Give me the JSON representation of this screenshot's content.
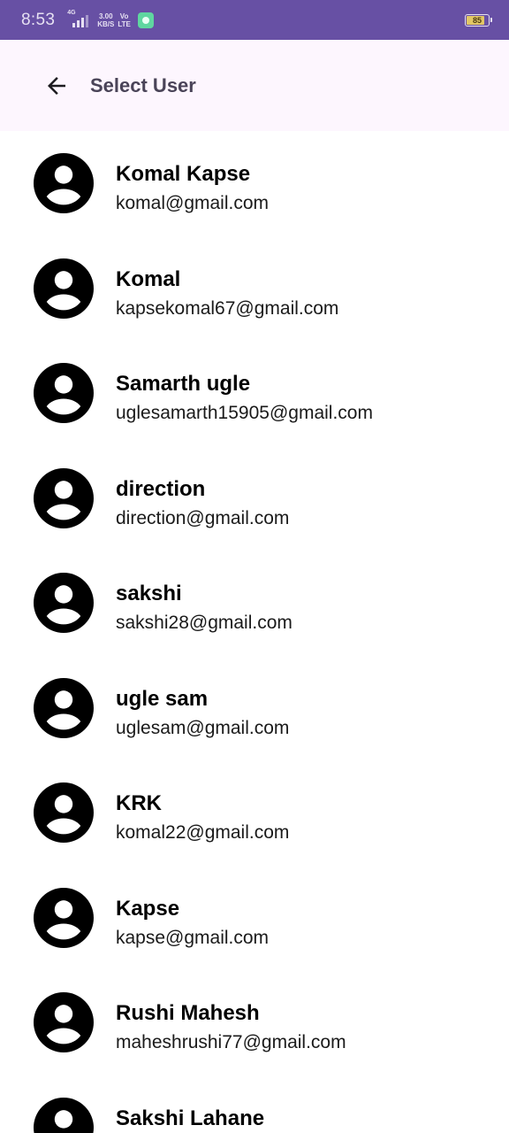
{
  "status_bar": {
    "time": "8:53",
    "network_tag": "4G",
    "speed_value": "3.00",
    "speed_unit": "KB/S",
    "volte_top": "Vo",
    "volte_bottom": "LTE",
    "battery_level": "85",
    "battery_fraction": 0.85
  },
  "app_bar": {
    "back_icon": "arrow-left-icon",
    "title": "Select User"
  },
  "users": [
    {
      "name": "Komal Kapse",
      "email": "komal@gmail.com"
    },
    {
      "name": "Komal",
      "email": "kapsekomal67@gmail.com"
    },
    {
      "name": "Samarth ugle",
      "email": "uglesamarth15905@gmail.com"
    },
    {
      "name": "direction",
      "email": "direction@gmail.com"
    },
    {
      "name": "sakshi",
      "email": "sakshi28@gmail.com"
    },
    {
      "name": "ugle sam",
      "email": "uglesam@gmail.com"
    },
    {
      "name": "KRK",
      "email": "komal22@gmail.com"
    },
    {
      "name": "Kapse",
      "email": "kapse@gmail.com"
    },
    {
      "name": "Rushi Mahesh",
      "email": "maheshrushi77@gmail.com"
    },
    {
      "name": "Sakshi Lahane",
      "email": ""
    }
  ],
  "colors": {
    "status_bar": "#6750a4",
    "app_bar": "#fdf6fe",
    "title_text": "#4a4458"
  }
}
